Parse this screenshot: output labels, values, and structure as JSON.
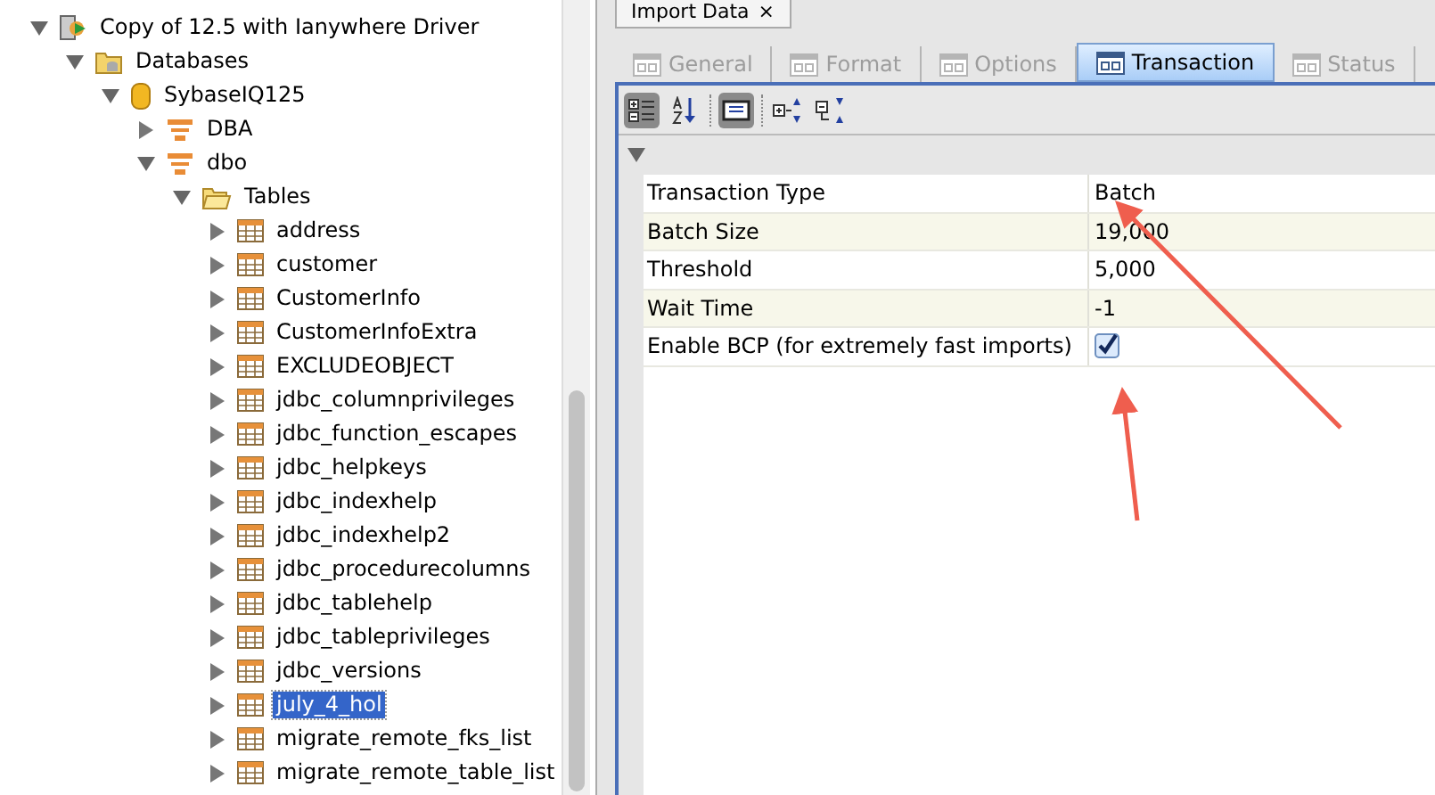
{
  "tree": [
    {
      "label": "Copy of 12.5 with Ianywhere Driver",
      "kind": "connection",
      "expanded": true,
      "selected": false,
      "children": [
        {
          "label": "Databases",
          "kind": "databases",
          "expanded": true,
          "selected": false,
          "children": [
            {
              "label": "SybaseIQ125",
              "kind": "database",
              "expanded": true,
              "selected": false,
              "children": [
                {
                  "label": "DBA",
                  "kind": "schema",
                  "expanded": false,
                  "selected": false
                },
                {
                  "label": "dbo",
                  "kind": "schema",
                  "expanded": true,
                  "selected": false,
                  "children": [
                    {
                      "label": "Tables",
                      "kind": "folder",
                      "expanded": true,
                      "selected": false,
                      "children": [
                        {
                          "label": "address",
                          "kind": "table",
                          "expanded": false,
                          "selected": false
                        },
                        {
                          "label": "customer",
                          "kind": "table",
                          "expanded": false,
                          "selected": false
                        },
                        {
                          "label": "CustomerInfo",
                          "kind": "table",
                          "expanded": false,
                          "selected": false
                        },
                        {
                          "label": "CustomerInfoExtra",
                          "kind": "table",
                          "expanded": false,
                          "selected": false
                        },
                        {
                          "label": "EXCLUDEOBJECT",
                          "kind": "table",
                          "expanded": false,
                          "selected": false
                        },
                        {
                          "label": "jdbc_columnprivileges",
                          "kind": "table",
                          "expanded": false,
                          "selected": false
                        },
                        {
                          "label": "jdbc_function_escapes",
                          "kind": "table",
                          "expanded": false,
                          "selected": false
                        },
                        {
                          "label": "jdbc_helpkeys",
                          "kind": "table",
                          "expanded": false,
                          "selected": false
                        },
                        {
                          "label": "jdbc_indexhelp",
                          "kind": "table",
                          "expanded": false,
                          "selected": false
                        },
                        {
                          "label": "jdbc_indexhelp2",
                          "kind": "table",
                          "expanded": false,
                          "selected": false
                        },
                        {
                          "label": "jdbc_procedurecolumns",
                          "kind": "table",
                          "expanded": false,
                          "selected": false
                        },
                        {
                          "label": "jdbc_tablehelp",
                          "kind": "table",
                          "expanded": false,
                          "selected": false
                        },
                        {
                          "label": "jdbc_tableprivileges",
                          "kind": "table",
                          "expanded": false,
                          "selected": false
                        },
                        {
                          "label": "jdbc_versions",
                          "kind": "table",
                          "expanded": false,
                          "selected": false
                        },
                        {
                          "label": "july_4_hol",
                          "kind": "table",
                          "expanded": false,
                          "selected": true
                        },
                        {
                          "label": "migrate_remote_fks_list",
                          "kind": "table",
                          "expanded": false,
                          "selected": false
                        },
                        {
                          "label": "migrate_remote_table_list",
                          "kind": "table",
                          "expanded": false,
                          "selected": false
                        }
                      ]
                    }
                  ]
                }
              ]
            }
          ]
        }
      ]
    }
  ],
  "editor_tab": {
    "title": "Import Data",
    "close": "×"
  },
  "tabs": [
    {
      "label": "General",
      "selected": false,
      "disabled": true
    },
    {
      "label": "Format",
      "selected": false,
      "disabled": true
    },
    {
      "label": "Options",
      "selected": false,
      "disabled": true
    },
    {
      "label": "Transaction",
      "selected": true,
      "disabled": false
    },
    {
      "label": "Status",
      "selected": false,
      "disabled": true
    }
  ],
  "toolbar": [
    {
      "kind": "categorized",
      "pressed": true
    },
    {
      "kind": "alphabetical",
      "pressed": false
    },
    {
      "kind": "description",
      "pressed": true
    },
    {
      "kind": "expand-all",
      "pressed": false
    },
    {
      "kind": "collapse-all",
      "pressed": false
    }
  ],
  "category": {
    "expanded": true
  },
  "properties": [
    {
      "name": "Transaction Type",
      "kind": "text",
      "value": "Batch"
    },
    {
      "name": "Batch Size",
      "kind": "text",
      "value": "19,000"
    },
    {
      "name": "Threshold",
      "kind": "text",
      "value": "5,000"
    },
    {
      "name": "Wait Time",
      "kind": "text",
      "value": "-1"
    },
    {
      "name": "Enable BCP (for extremely fast imports)",
      "kind": "checkbox",
      "checked": true
    }
  ]
}
